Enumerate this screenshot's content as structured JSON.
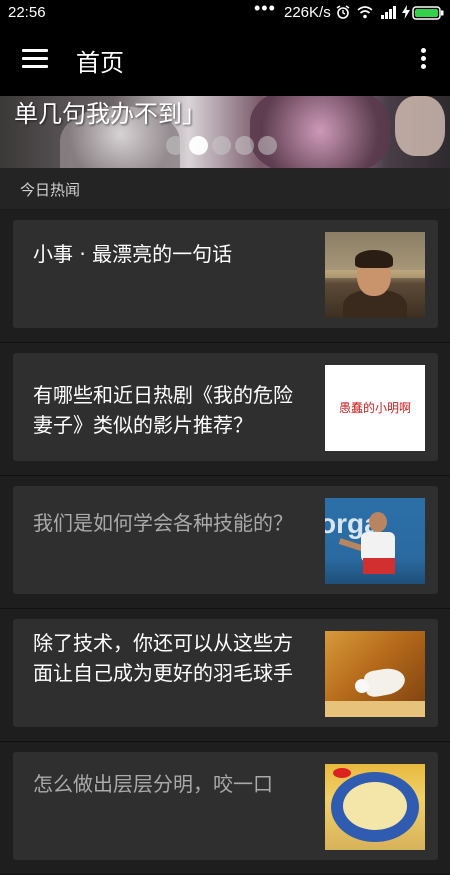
{
  "status_bar": {
    "time": "22:56",
    "more": "•••",
    "net_speed": "226K/s",
    "icons": [
      "alarm-icon",
      "wifi-icon",
      "signal-icon",
      "charging-icon",
      "battery-icon"
    ]
  },
  "app_bar": {
    "title": "首页",
    "icons": [
      "menu-icon",
      "overflow-menu-icon"
    ]
  },
  "banner": {
    "caption": "单几句我办不到」",
    "pages": 5,
    "active_page": 2
  },
  "section": {
    "title": "今日热闻"
  },
  "feed": [
    {
      "title": "小事 · 最漂亮的一句话",
      "read": false,
      "thumb_text": ""
    },
    {
      "title": "有哪些和近日热剧《我的危险妻子》类似的影片推荐？",
      "read": false,
      "thumb_text": "愚蠢的小明啊"
    },
    {
      "title": "我们是如何学会各种技能的？",
      "read": true,
      "thumb_text": "orga"
    },
    {
      "title": "除了技术，你还可以从这些方面让自己成为更好的羽毛球手",
      "read": false,
      "thumb_text": ""
    },
    {
      "title": "怎么做出层层分明，咬一口",
      "read": true,
      "thumb_text": ""
    }
  ],
  "colors": {
    "background": "#1b1b1b",
    "card": "#2f2f2f",
    "app_bar": "#000000",
    "title_unread": "#ffffff",
    "title_read": "#a9a9a9"
  }
}
